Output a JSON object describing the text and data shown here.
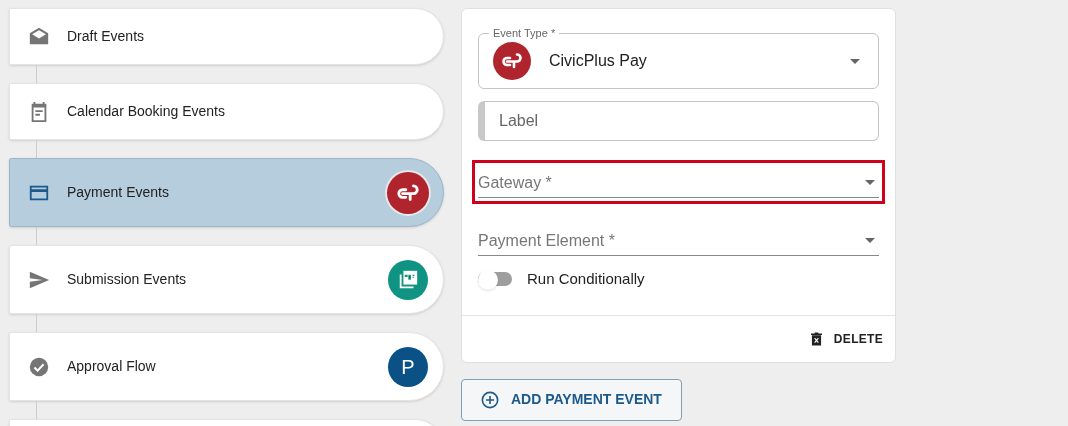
{
  "sidebar": {
    "items": [
      {
        "label": "Draft Events",
        "kind": "draft",
        "selected": false
      },
      {
        "label": "Calendar Booking Events",
        "kind": "calendar",
        "selected": false
      },
      {
        "label": "Payment Events",
        "kind": "payment",
        "selected": true,
        "badge": {
          "kind": "civicplus"
        }
      },
      {
        "label": "Submission Events",
        "kind": "submission",
        "selected": false,
        "badge": {
          "kind": "pdf"
        }
      },
      {
        "label": "Approval Flow",
        "kind": "approval",
        "selected": false,
        "badge": {
          "kind": "letter",
          "text": "P"
        }
      },
      {
        "selected": false
      }
    ]
  },
  "event_card": {
    "event_type": {
      "label": "Event Type *",
      "value": "CivicPlus Pay"
    },
    "label_field": {
      "placeholder": "Label"
    },
    "selects": [
      {
        "placeholder": "Gateway *",
        "highlighted": true
      },
      {
        "placeholder": "Payment Element *",
        "highlighted": false
      }
    ],
    "toggle": {
      "label": "Run Conditionally",
      "on": false
    },
    "delete_button": "DELETE"
  },
  "add_button": "ADD PAYMENT EVENT"
}
